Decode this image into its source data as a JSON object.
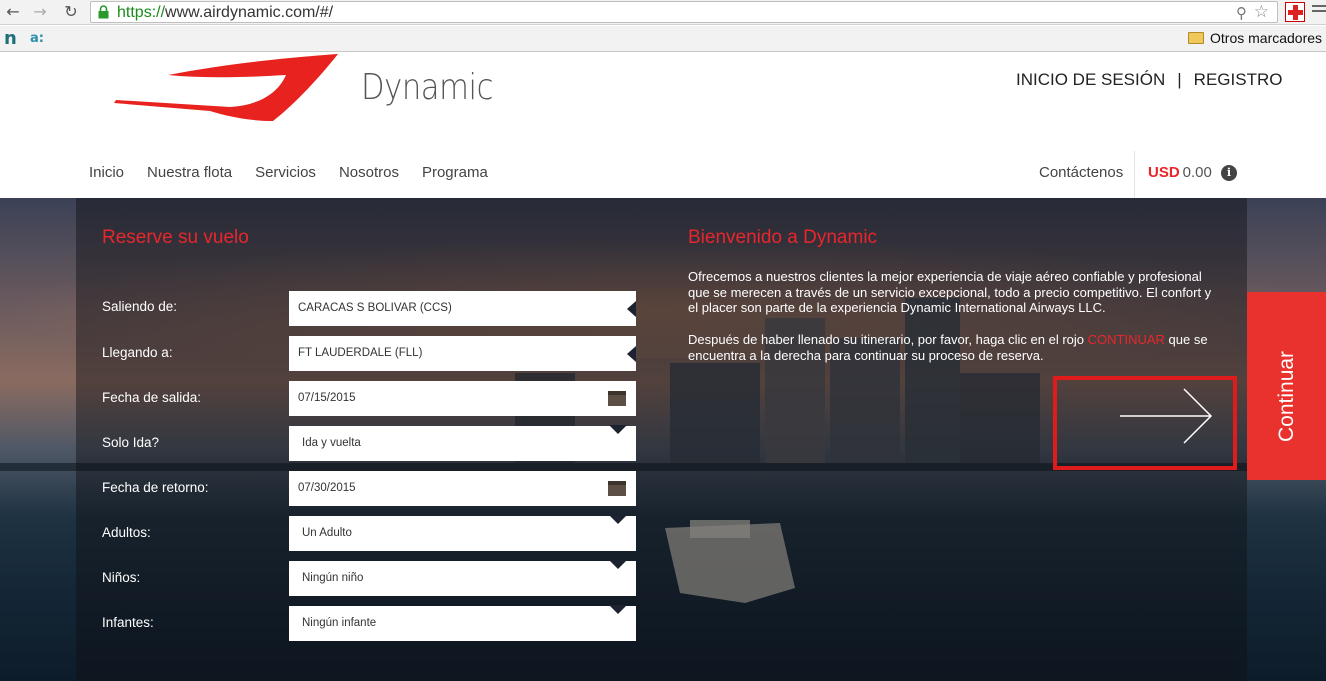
{
  "browser": {
    "url_secure": "https://",
    "url_domain": "www.airdynamic.com",
    "url_path": "/#/",
    "bookmark_n": "n",
    "bookmark_a": "a:",
    "bookmark_folder": "Otros marcadores"
  },
  "header": {
    "brand": "Dynamic",
    "login": "INICIO DE SESIÓN",
    "separator": "|",
    "register": "REGISTRO",
    "nav": [
      "Inicio",
      "Nuestra flota",
      "Servicios",
      "Nosotros",
      "Programa"
    ],
    "contact": "Contáctenos",
    "currency_code": "USD",
    "currency_amount": "0.00",
    "info": "i"
  },
  "booking": {
    "title": "Reserve su vuelo",
    "fields": [
      {
        "label": "Saliendo de:",
        "value": "CARACAS S BOLIVAR (CCS)"
      },
      {
        "label": "Llegando a:",
        "value": "FT LAUDERDALE (FLL)"
      },
      {
        "label": "Fecha de salida:",
        "value": "07/15/2015"
      },
      {
        "label": "Solo Ida?",
        "value": "Ida y vuelta"
      },
      {
        "label": "Fecha de retorno:",
        "value": "07/30/2015"
      },
      {
        "label": "Adultos:",
        "value": "Un Adulto"
      },
      {
        "label": "Niños:",
        "value": "Ningún niño"
      },
      {
        "label": "Infantes:",
        "value": "Ningún infante"
      }
    ]
  },
  "welcome": {
    "title": "Bienvenido a Dynamic",
    "paragraph1": "Ofrecemos a nuestros clientes la mejor experiencia de viaje aéreo confiable y profesional que se merecen a través de un servicio excepcional, todo a precio competitivo. El confort y el placer son parte de la experiencia Dynamic International Airways LLC.",
    "paragraph2_before": "Después de haber llenado su itinerario, por favor, haga clic en el rojo ",
    "paragraph2_highlight": "CONTINUAR",
    "paragraph2_after": " que se encuentra a la derecha para continuar su proceso de reserva."
  },
  "continue_tab": "Continuar",
  "colors": {
    "accent": "#e8262b",
    "highlight_box": "#e01b1b"
  }
}
